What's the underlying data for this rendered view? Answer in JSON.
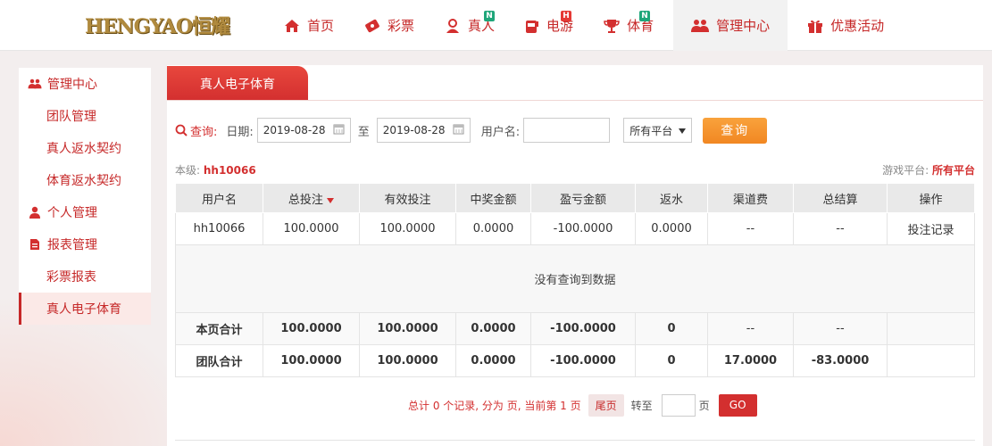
{
  "brand": {
    "logo_text": "HENGYAO恒耀"
  },
  "nav": [
    {
      "label": "首页",
      "icon": "home-icon",
      "badge": ""
    },
    {
      "label": "彩票",
      "icon": "lottery-ticket-icon",
      "badge": ""
    },
    {
      "label": "真人",
      "icon": "live-dealer-icon",
      "badge": "N"
    },
    {
      "label": "电游",
      "icon": "slot-machine-icon",
      "badge": "H"
    },
    {
      "label": "体育",
      "icon": "trophy-icon",
      "badge": "N"
    },
    {
      "label": "管理中心",
      "icon": "users-icon",
      "badge": "",
      "active": true
    },
    {
      "label": "优惠活动",
      "icon": "gift-icon",
      "badge": ""
    }
  ],
  "sidebar": {
    "items": [
      {
        "label": "管理中心",
        "type": "group",
        "icon": "users-icon"
      },
      {
        "label": "团队管理",
        "type": "sub"
      },
      {
        "label": "真人返水契约",
        "type": "sub"
      },
      {
        "label": "体育返水契约",
        "type": "sub"
      },
      {
        "label": "个人管理",
        "type": "group",
        "icon": "user-icon"
      },
      {
        "label": "报表管理",
        "type": "group",
        "icon": "report-icon"
      },
      {
        "label": "彩票报表",
        "type": "sub"
      },
      {
        "label": "真人电子体育",
        "type": "sub",
        "active": true
      }
    ]
  },
  "main": {
    "tab_title": "真人电子体育",
    "filter": {
      "query_label": "查询:",
      "date_label": "日期:",
      "date_from": "2019-08-28",
      "to_label": "至",
      "date_to": "2019-08-28",
      "username_label": "用户名:",
      "username_value": "",
      "platform_selected": "所有平台",
      "query_button": "查询"
    },
    "meta": {
      "level_label": "本级:",
      "level_user": "hh10066",
      "platform_label": "游戏平台:",
      "platform_value": "所有平台"
    },
    "table": {
      "headers": [
        "用户名",
        "总投注",
        "有效投注",
        "中奖金额",
        "盈亏金额",
        "返水",
        "渠道费",
        "总结算",
        "操作"
      ],
      "row": [
        "hh10066",
        "100.0000",
        "100.0000",
        "0.0000",
        "-100.0000",
        "0.0000",
        "--",
        "--",
        "投注记录"
      ],
      "empty_text": "没有查询到数据",
      "page_total": [
        "本页合计",
        "100.0000",
        "100.0000",
        "0.0000",
        "-100.0000",
        "0",
        "--",
        "--",
        ""
      ],
      "team_total": [
        "团队合计",
        "100.0000",
        "100.0000",
        "0.0000",
        "-100.0000",
        "0",
        "17.0000",
        "-83.0000",
        ""
      ]
    },
    "pager": {
      "summary": "总计 0 个记录, 分为 页, 当前第 1 页",
      "last_label": "尾页",
      "goto_label": "转至",
      "page_unit": "页",
      "go_button": "GO"
    }
  },
  "colors": {
    "accent": "#d32f2f",
    "query_button": "#f18722",
    "badge_new": "#1fa67a",
    "badge_hot": "#e53935"
  }
}
